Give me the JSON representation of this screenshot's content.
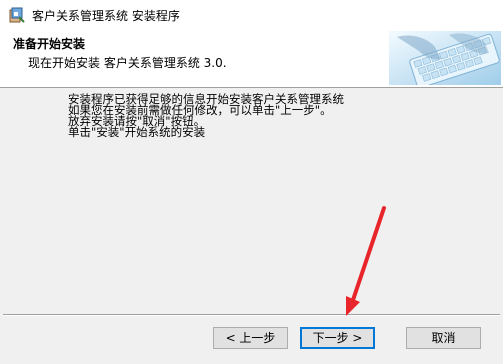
{
  "window": {
    "title": "客户关系管理系统 安装程序"
  },
  "banner": {
    "title": "准备开始安装",
    "subtitle": "现在开始安装 客户关系管理系统 3.0."
  },
  "body": {
    "lines": [
      "安装程序已获得足够的信息开始安装客户关系管理系统",
      "如果您在安装前需做任何修改，可以单击\"上一步\"。",
      "放弃安装请按\"取消\"按钮。",
      "单击\"安装\"开始系统的安装"
    ]
  },
  "buttons": {
    "back_label": "< 上一步",
    "next_label": "下一步 >",
    "cancel_label": "取消"
  },
  "colors": {
    "annotation_arrow": "#e8252a",
    "default_button_border": "#0078d7"
  },
  "icons": {
    "title_icon": "installer-icon",
    "banner_image": "keyboard-typing-image"
  }
}
